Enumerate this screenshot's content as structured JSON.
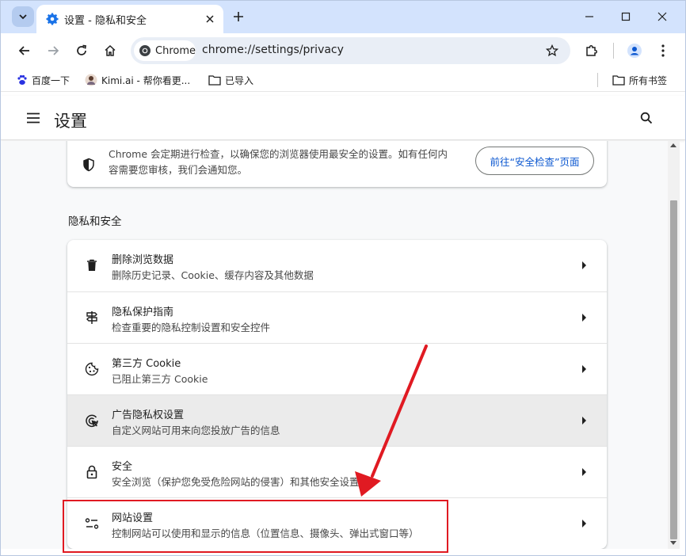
{
  "browser": {
    "tab_title": "设置 - 隐私和安全",
    "omnibox_chip": "Chrome",
    "url": "chrome://settings/privacy"
  },
  "bookmarks": {
    "items": [
      {
        "label": "百度一下",
        "icon": "baidu-paw-icon"
      },
      {
        "label": "Kimi.ai - 帮你看更...",
        "icon": "kimi-avatar-icon"
      },
      {
        "label": "已导入",
        "icon": "folder-icon"
      }
    ],
    "all_bookmarks": "所有书签"
  },
  "settings": {
    "title": "设置",
    "safety_text": "Chrome 会定期进行检查，以确保您的浏览器使用最安全的设置。如有任何内容需要您审核，我们会通知您。",
    "safety_button": "前往“安全检查”页面",
    "section_title": "隐私和安全",
    "rows": [
      {
        "title": "删除浏览数据",
        "subtitle": "删除历史记录、Cookie、缓存内容及其他数据",
        "icon": "trash-icon"
      },
      {
        "title": "隐私保护指南",
        "subtitle": "检查重要的隐私控制设置和安全控件",
        "icon": "signpost-icon"
      },
      {
        "title": "第三方 Cookie",
        "subtitle": "已阻止第三方 Cookie",
        "icon": "cookie-icon"
      },
      {
        "title": "广告隐私权设置",
        "subtitle": "自定义网站可用来向您投放广告的信息",
        "icon": "ad-privacy-icon"
      },
      {
        "title": "安全",
        "subtitle": "安全浏览（保护您免受危险网站的侵害）和其他安全设置",
        "icon": "lock-icon"
      },
      {
        "title": "网站设置",
        "subtitle": "控制网站可以使用和显示的信息（位置信息、摄像头、弹出式窗口等）",
        "icon": "tune-icon"
      }
    ]
  },
  "colors": {
    "accent": "#0b57d0",
    "annotation": "#e01a22",
    "tabstrip": "#d3e3fd"
  }
}
